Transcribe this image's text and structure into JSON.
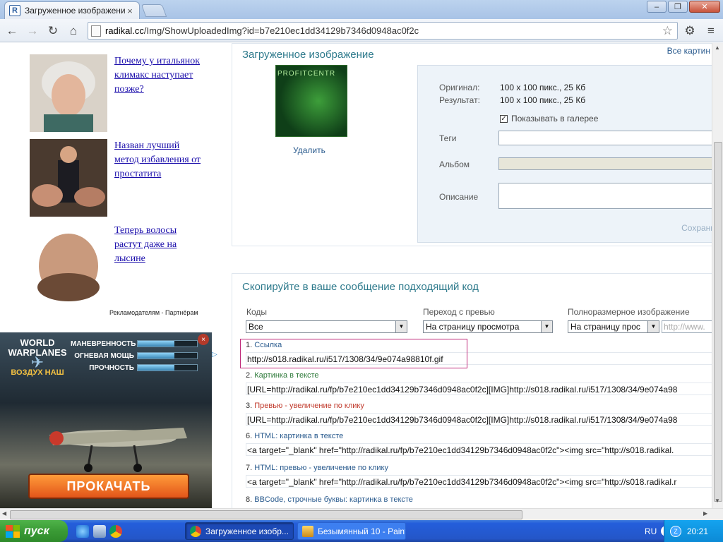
{
  "browser": {
    "tab_title": "Загруженное изображение",
    "tab_close": "×",
    "url_host": "radikal.cc",
    "url_path": "/Img/ShowUploadedImg?id=b7e210ec1dd34129b7346d0948ac0f2c",
    "window_minimize": "–",
    "window_maximize": "❐",
    "window_close": "✕"
  },
  "ads": {
    "items": [
      {
        "text": "Почему у итальянок климакс наступает позже?",
        "image": "elderly-woman-photo"
      },
      {
        "text": "Назван лучший метод избавления от простатита",
        "image": "man-with-women-photo"
      },
      {
        "text": "Теперь волосы растут даже на лысине",
        "image": "bald-head-photo"
      }
    ],
    "footer": "Рекламодателям - Партнёрам",
    "banner": {
      "logo_line1": "WORLD",
      "logo_line2": "WARPLANES",
      "logo_sub": "ВОЗДУХ НАШ",
      "stats": [
        {
          "label": "МАНЕВРЕННОСТЬ",
          "level": 0.62
        },
        {
          "label": "ОГНЕВАЯ МОЩЬ",
          "level": 0.62
        },
        {
          "label": "ПРОЧНОСТЬ",
          "level": 0.62
        }
      ],
      "close": "×",
      "cta": "ПРОКАЧАТЬ"
    }
  },
  "upload": {
    "heading": "Загруженное изображение",
    "all_pictures": "Все картин",
    "thumb_text": "PROFITCENTR",
    "delete": "Удалить",
    "original_label": "Оригинал:",
    "original_value": "100 x 100 пикс., 25 Кб",
    "result_label": "Результат:",
    "result_value": "100 x 100 пикс., 25 Кб",
    "show_in_gallery": "Показывать в галерее",
    "show_in_gallery_checked": true,
    "tags_label": "Теги",
    "album_label": "Альбом",
    "description_label": "Описание",
    "save": "Сохрани"
  },
  "codes": {
    "heading": "Скопируйте в ваше сообщение подходящий код",
    "codes_label": "Коды",
    "codes_value": "Все",
    "preview_label": "Переход с превью",
    "preview_value": "На страницу просмотра",
    "full_label": "Полноразмерное изображение",
    "full_value": "На страницу прос",
    "url_placeholder": "http://www.",
    "items": [
      {
        "num": "1.",
        "title": "Ссылка",
        "value": "http://s018.radikal.ru/i517/1308/34/9e074a98810f.gif"
      },
      {
        "num": "2.",
        "title": "Картинка в тексте",
        "value": "[URL=http://radikal.ru/fp/b7e210ec1dd34129b7346d0948ac0f2c][IMG]http://s018.radikal.ru/i517/1308/34/9e074a98"
      },
      {
        "num": "3.",
        "title": "Превью - увеличение по клику",
        "value": "[URL=http://radikal.ru/fp/b7e210ec1dd34129b7346d0948ac0f2c][IMG]http://s018.radikal.ru/i517/1308/34/9e074a98"
      },
      {
        "num": "6.",
        "title": "HTML: картинка в тексте",
        "value": "<a target=\"_blank\" href=\"http://radikal.ru/fp/b7e210ec1dd34129b7346d0948ac0f2c\"><img src=\"http://s018.radikal."
      },
      {
        "num": "7.",
        "title": "HTML: превью - увеличение по клику",
        "value": "<a target=\"_blank\" href=\"http://radikal.ru/fp/b7e210ec1dd34129b7346d0948ac0f2c\"><img src=\"http://s018.radikal.r"
      },
      {
        "num": "8.",
        "title": "BBCode, строчные буквы: картинка в тексте",
        "value": ""
      }
    ]
  },
  "taskbar": {
    "start": "пуск",
    "tasks": [
      {
        "label": "Загруженное изобр...",
        "active": true
      },
      {
        "label": "Безымянный 10 - Paint",
        "active": false
      }
    ],
    "lang": "RU",
    "clock": "20:21"
  },
  "colors": {
    "accent_teal": "#2e7a8c",
    "link_blue": "#1a0dab",
    "taskbar_blue": "#245edb",
    "start_green": "#3a9a35"
  }
}
